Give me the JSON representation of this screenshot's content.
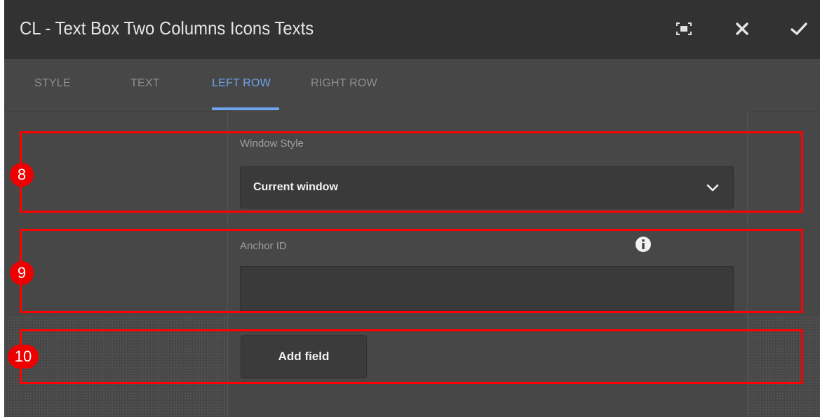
{
  "dialog": {
    "title": "CL - Text Box Two Columns Icons Texts",
    "icons": [
      "fullscreen-icon",
      "close-icon",
      "checkmark-icon"
    ]
  },
  "tabs": [
    {
      "label": "STYLE",
      "active": false
    },
    {
      "label": "TEXT",
      "active": false
    },
    {
      "label": "LEFT ROW",
      "active": true
    },
    {
      "label": "RIGHT ROW",
      "active": false
    }
  ],
  "form": {
    "window_style": {
      "label": "Window Style",
      "value": "Current window"
    },
    "anchor_id": {
      "label": "Anchor ID",
      "value": "",
      "info_icon": "info-icon"
    },
    "add_field_label": "Add field"
  },
  "annotations": [
    {
      "number": "8",
      "target": "window_style"
    },
    {
      "number": "9",
      "target": "anchor_id"
    },
    {
      "number": "10",
      "target": "add_field"
    }
  ],
  "colors": {
    "accent": "#6ea4f0",
    "annotation_red": "#ee0000",
    "header_bg": "#323232",
    "panel_bg": "#474747"
  }
}
